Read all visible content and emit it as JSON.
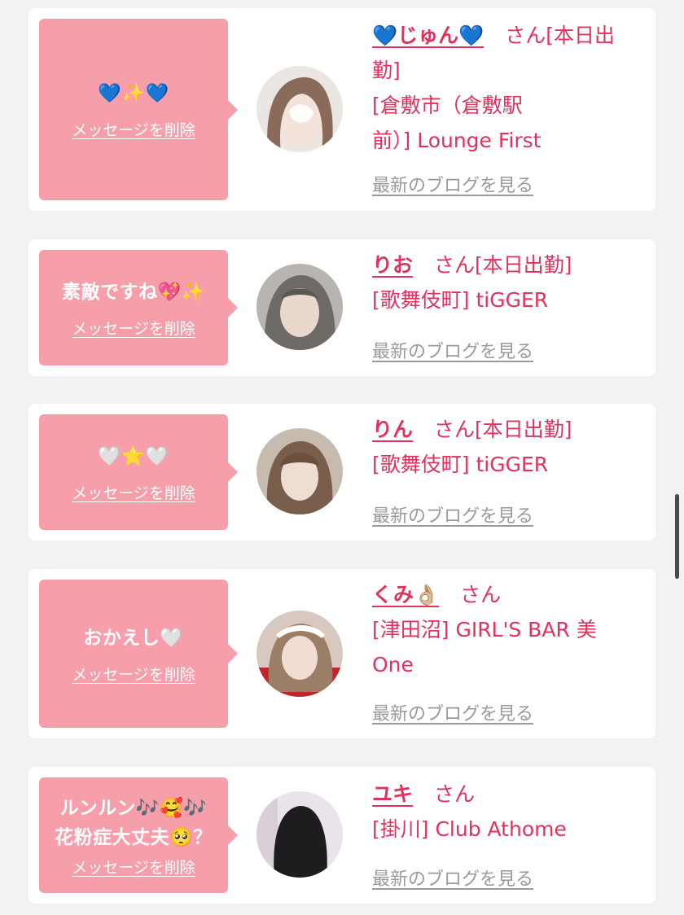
{
  "accent_color": "#e0325c",
  "bubble_color": "#f79eab",
  "common": {
    "delete_label": "メッセージを削除",
    "blog_label": "最新のブログを見る"
  },
  "items": [
    {
      "message": "💙✨💙",
      "name": "💙じゅん💙",
      "suffix": "さん[本日出",
      "lines": [
        "勤]",
        "[倉敷市（倉敷駅",
        "前）] Lounge First"
      ]
    },
    {
      "message": "素敵ですね💖✨",
      "name": "りお",
      "suffix": "さん[本日出勤]",
      "lines": [
        "[歌舞伎町] tiGGER"
      ]
    },
    {
      "message": "🤍⭐🤍",
      "name": "りん",
      "suffix": "さん[本日出勤]",
      "lines": [
        "[歌舞伎町] tiGGER"
      ]
    },
    {
      "message": "おかえし🤍",
      "name": "くみ👌🏼",
      "suffix": "さん",
      "lines": [
        "[津田沼] GIRL'S BAR 美",
        "One"
      ]
    },
    {
      "message": "ルンルン🎶🥰🎶\n花粉症大丈夫🥺？",
      "name": "ユキ",
      "suffix": "さん",
      "lines": [
        "[掛川] Club Athome"
      ]
    }
  ]
}
